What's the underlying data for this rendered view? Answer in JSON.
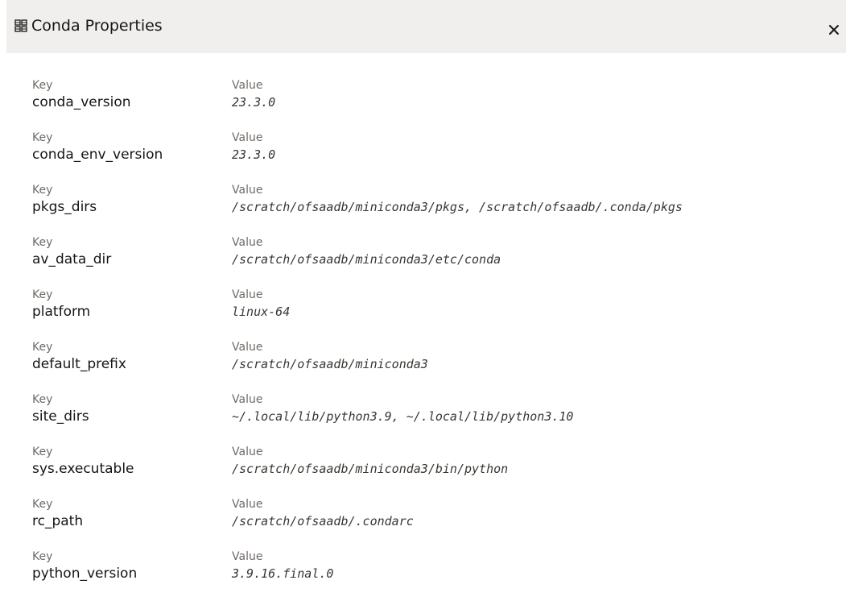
{
  "dialog": {
    "title": "Conda Properties",
    "header_icon": "properties-grid-icon",
    "close_icon": "close-icon",
    "header_bg": "#f1efed"
  },
  "labels": {
    "key": "Key",
    "value": "Value"
  },
  "properties": [
    {
      "key_label": "Key",
      "key": "conda_version",
      "value_label": "Value",
      "value": "23.3.0"
    },
    {
      "key_label": "Key",
      "key": "conda_env_version",
      "value_label": "Value",
      "value": "23.3.0"
    },
    {
      "key_label": "Key",
      "key": "pkgs_dirs",
      "value_label": "Value",
      "value": "/scratch/ofsaadb/miniconda3/pkgs, /scratch/ofsaadb/.conda/pkgs"
    },
    {
      "key_label": "Key",
      "key": "av_data_dir",
      "value_label": "Value",
      "value": "/scratch/ofsaadb/miniconda3/etc/conda"
    },
    {
      "key_label": "Key",
      "key": "platform",
      "value_label": "Value",
      "value": "linux-64"
    },
    {
      "key_label": "Key",
      "key": "default_prefix",
      "value_label": "Value",
      "value": "/scratch/ofsaadb/miniconda3"
    },
    {
      "key_label": "Key",
      "key": "site_dirs",
      "value_label": "Value",
      "value": "~/.local/lib/python3.9, ~/.local/lib/python3.10"
    },
    {
      "key_label": "Key",
      "key": "sys.executable",
      "value_label": "Value",
      "value": "/scratch/ofsaadb/miniconda3/bin/python"
    },
    {
      "key_label": "Key",
      "key": "rc_path",
      "value_label": "Value",
      "value": "/scratch/ofsaadb/.condarc"
    },
    {
      "key_label": "Key",
      "key": "python_version",
      "value_label": "Value",
      "value": "3.9.16.final.0"
    }
  ]
}
